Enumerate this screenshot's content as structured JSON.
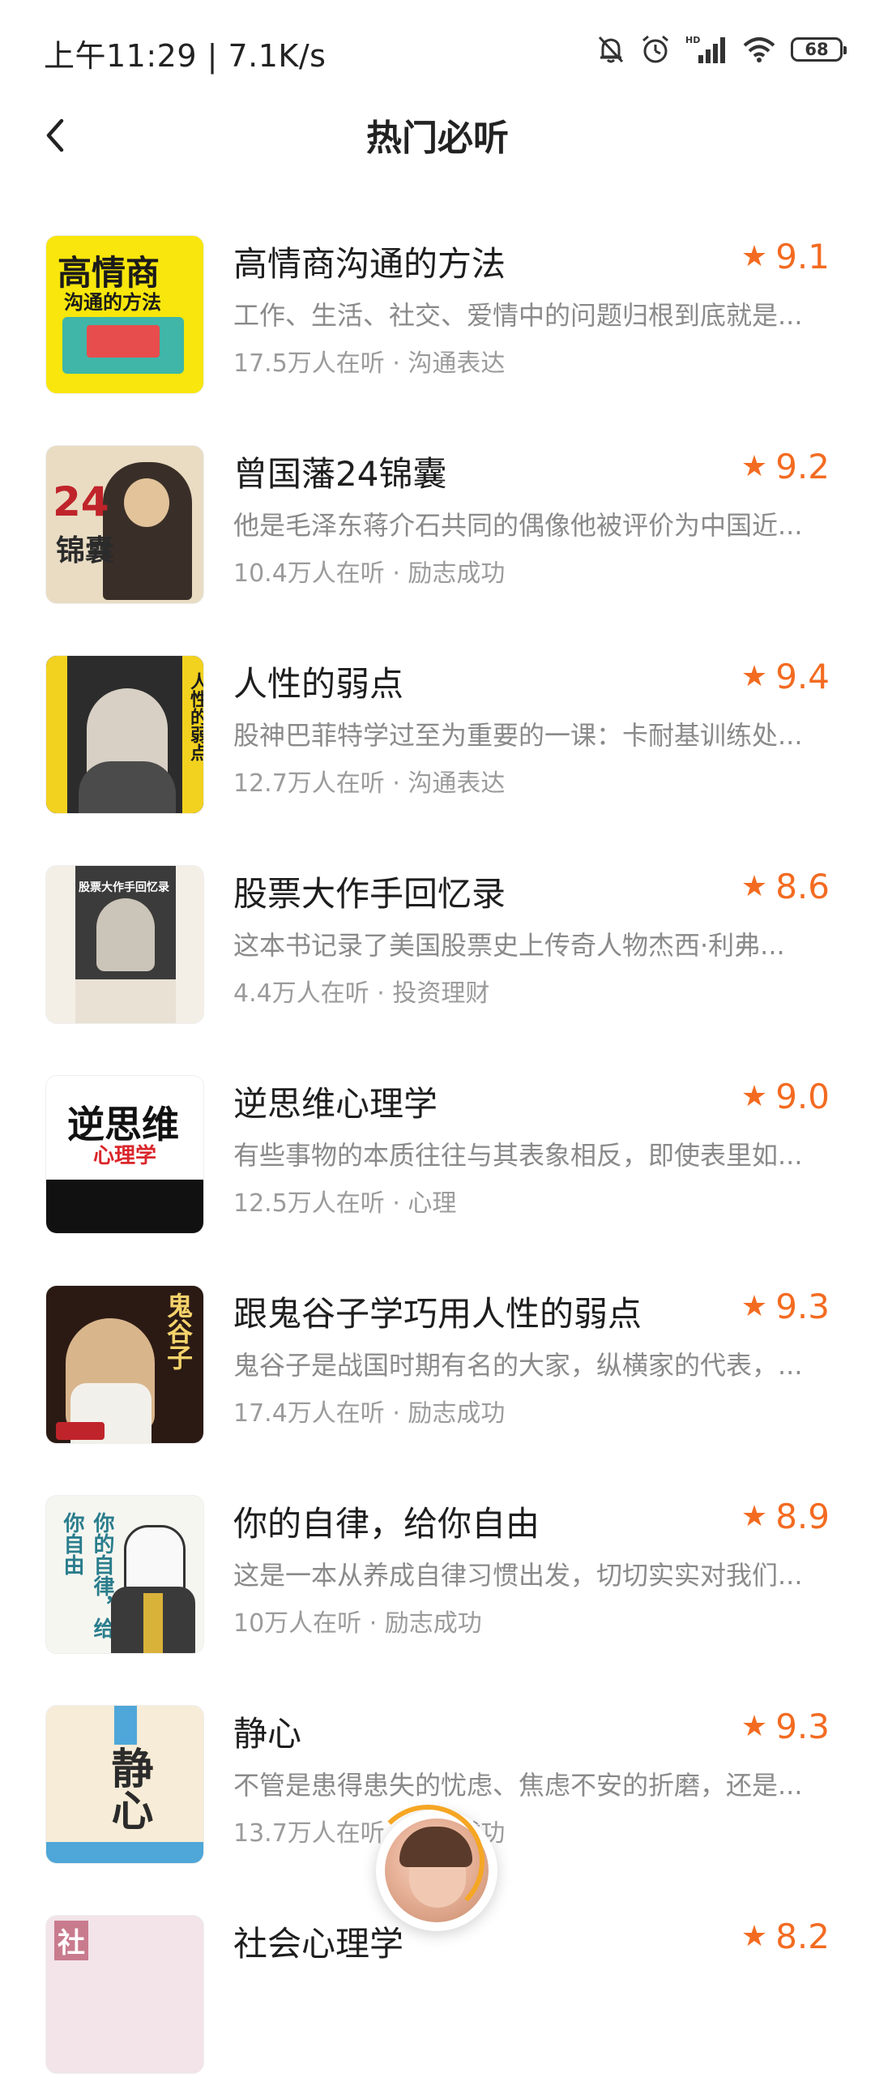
{
  "status_bar": {
    "time": "上午11:29 | 7.1K/s",
    "battery": "68"
  },
  "header": {
    "title": "热门必听"
  },
  "books": [
    {
      "title": "高情商沟通的方法",
      "rating": "9.1",
      "desc": "工作、生活、社交、爱情中的问题归根到底就是...",
      "listeners": "17.5万人在听",
      "category": "沟通表达",
      "cover_text": "高情商",
      "cover_sub": "沟通的方法",
      "cover_color": "#f8e60c"
    },
    {
      "title": "曾国藩24锦囊",
      "rating": "9.2",
      "desc": "他是毛泽东蒋介石共同的偶像他被评价为中国近...",
      "listeners": "10.4万人在听",
      "category": "励志成功",
      "cover_text": "24",
      "cover_sub": "锦囊",
      "cover_color": "#e9dcc3"
    },
    {
      "title": "人性的弱点",
      "rating": "9.4",
      "desc": "股神巴菲特学过至为重要的一课：卡耐基训练处...",
      "listeners": "12.7万人在听",
      "category": "沟通表达",
      "cover_text": "人性的弱点",
      "cover_sub": "",
      "cover_color": "#2c2c2c"
    },
    {
      "title": "股票大作手回忆录",
      "rating": "8.6",
      "desc": "这本书记录了美国股票史上传奇人物杰西·利弗...",
      "listeners": "4.4万人在听",
      "category": "投资理财",
      "cover_text": "股票大作手回忆录",
      "cover_sub": "",
      "cover_color": "#f4efe6"
    },
    {
      "title": "逆思维心理学",
      "rating": "9.0",
      "desc": "有些事物的本质往往与其表象相反，即使表里如...",
      "listeners": "12.5万人在听",
      "category": "心理",
      "cover_text": "逆思维",
      "cover_sub": "心理学",
      "cover_color": "#ffffff"
    },
    {
      "title": "跟鬼谷子学巧用人性的弱点",
      "rating": "9.3",
      "desc": "鬼谷子是战国时期有名的大家，纵横家的代表，...",
      "listeners": "17.4万人在听",
      "category": "励志成功",
      "cover_text": "鬼谷子",
      "cover_sub": "",
      "cover_color": "#2b1a14"
    },
    {
      "title": "你的自律，给你自由",
      "rating": "8.9",
      "desc": "这是一本从养成自律习惯出发，切切实实对我们...",
      "listeners": "10万人在听",
      "category": "励志成功",
      "cover_text": "你的自律，给你自由",
      "cover_sub": "",
      "cover_color": "#f6f6f1"
    },
    {
      "title": "静心",
      "rating": "9.3",
      "desc": "不管是患得患失的忧虑、焦虑不安的折磨，还是...",
      "listeners": "13.7万人在听",
      "category": "励志成功",
      "cover_text": "静心",
      "cover_sub": "",
      "cover_color": "#f7ecd7"
    },
    {
      "title": "社会心理学",
      "rating": "8.2",
      "desc": "",
      "listeners": "",
      "category": "",
      "cover_text": "社",
      "cover_sub": "",
      "cover_color": "#f2e4e8"
    }
  ],
  "colors": {
    "rating": "#f36b21",
    "meta": "#9b9b9b",
    "desc": "#8a8a8a"
  }
}
